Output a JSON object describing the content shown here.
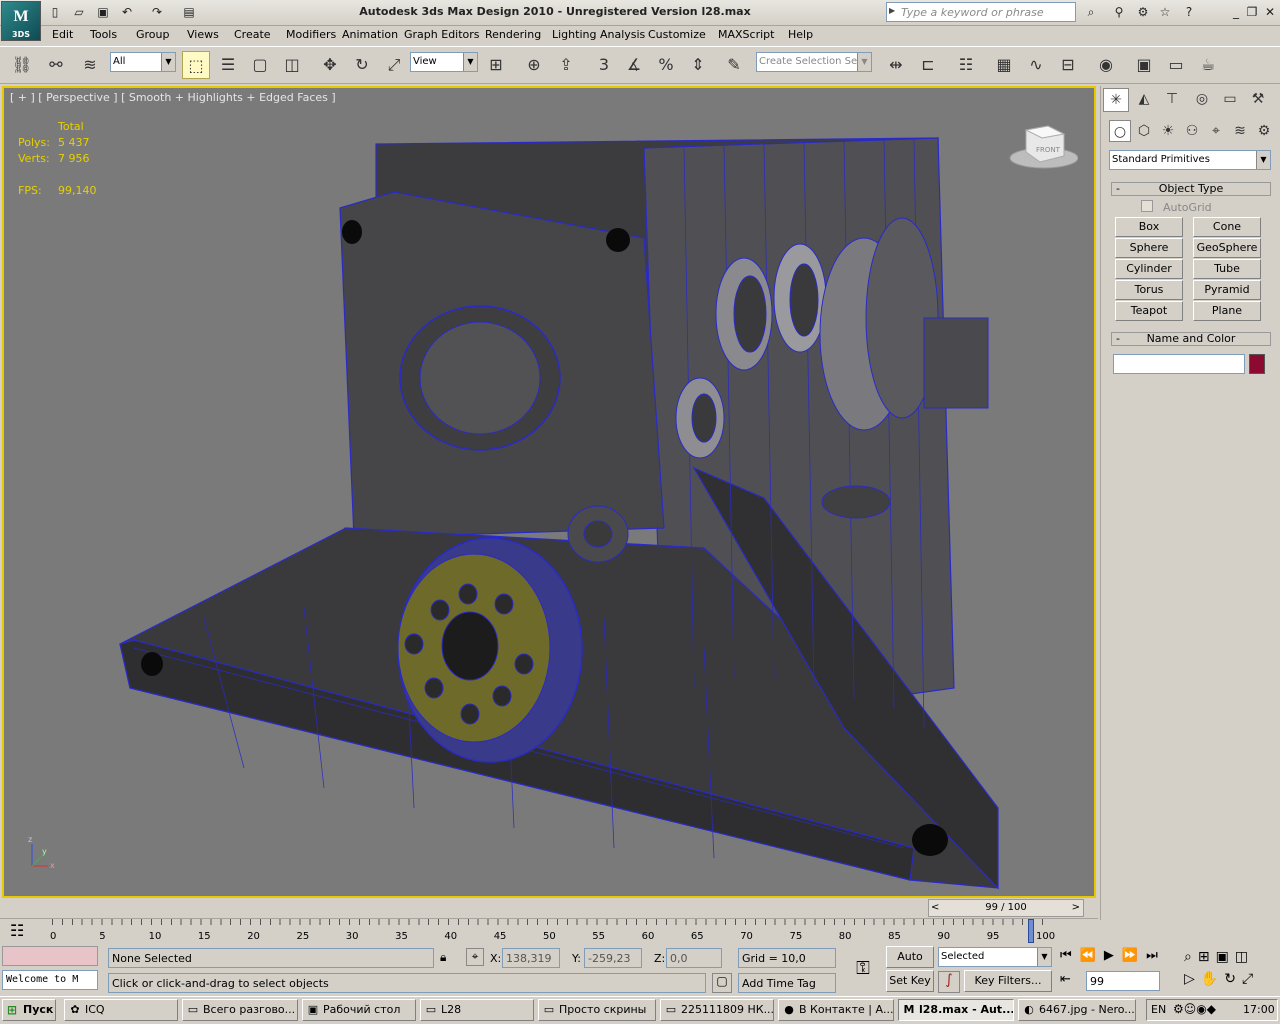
{
  "app": {
    "title": "Autodesk 3ds Max Design 2010    -    Unregistered Version        l28.max",
    "logo_text": "M",
    "logo_sub": "3DS"
  },
  "search": {
    "placeholder": "Type a keyword or phrase"
  },
  "menu": {
    "items": [
      "Edit",
      "Tools",
      "Group",
      "Views",
      "Create",
      "Modifiers",
      "Animation",
      "Graph Editors",
      "Rendering",
      "Lighting Analysis",
      "Customize",
      "MAXScript",
      "Help"
    ]
  },
  "toolbar": {
    "filter_value": "All",
    "refcoord_value": "View",
    "selection_set_placeholder": "Create Selection Se",
    "angle_snap_label": "3",
    "percent_label": "%"
  },
  "viewport": {
    "label": "[ + ] [ Perspective ] [ Smooth + Highlights + Edged Faces ]",
    "stats": {
      "total_label": "Total",
      "polys_label": "Polys:",
      "polys_value": "5 437",
      "verts_label": "Verts:",
      "verts_value": "7 956",
      "fps_label": "FPS:",
      "fps_value": "99,140"
    },
    "viewcube_label": "FRONT",
    "axis_labels": {
      "z": "z",
      "y": "y",
      "x": "x"
    }
  },
  "timeline": {
    "slider_text": "99 / 100",
    "prev": "<",
    "next": ">",
    "ticks": [
      "0",
      "5",
      "10",
      "15",
      "20",
      "25",
      "30",
      "35",
      "40",
      "45",
      "50",
      "55",
      "60",
      "65",
      "70",
      "75",
      "80",
      "85",
      "90",
      "95",
      "100"
    ]
  },
  "status": {
    "listener_text": "Welcome to M",
    "selection": "None Selected",
    "prompt": "Click or click-and-drag to select objects",
    "x_label": "X:",
    "x_value": "138,319",
    "y_label": "Y:",
    "y_value": "-259,23",
    "z_label": "Z:",
    "z_value": "0,0",
    "grid": "Grid = 10,0",
    "add_time_tag": "Add Time Tag",
    "auto_key": "Auto Key",
    "set_key": "Set Key",
    "key_mode": "Selected",
    "key_filters": "Key Filters...",
    "frame": "99"
  },
  "command_panel": {
    "category": "Standard Primitives",
    "object_type_header": "Object Type",
    "autogrid_label": "AutoGrid",
    "buttons": [
      "Box",
      "Cone",
      "Sphere",
      "GeoSphere",
      "Cylinder",
      "Tube",
      "Torus",
      "Pyramid",
      "Teapot",
      "Plane"
    ],
    "name_color_header": "Name and Color",
    "name_value": "",
    "swatch_color": "#8c0a32"
  },
  "taskbar": {
    "start_label": "Пуск",
    "tasks": [
      {
        "label": "ICQ",
        "icon": "icq-icon",
        "glyph": "✿"
      },
      {
        "label": "Всего разгово...",
        "icon": "folder-icon",
        "glyph": "▭"
      },
      {
        "label": "Рабочий стол",
        "icon": "desktop-icon",
        "glyph": "▣"
      },
      {
        "label": "L28",
        "icon": "folder-icon",
        "glyph": "▭"
      },
      {
        "label": "Просто скрины",
        "icon": "folder-icon",
        "glyph": "▭"
      },
      {
        "label": "225111809 НК...",
        "icon": "folder-icon",
        "glyph": "▭"
      },
      {
        "label": "В Контакте | А...",
        "icon": "firefox-icon",
        "glyph": "●"
      },
      {
        "label": "l28.max - Aut...",
        "icon": "max-icon",
        "glyph": "M"
      },
      {
        "label": "6467.jpg - Nero...",
        "icon": "nero-icon",
        "glyph": "◐"
      }
    ],
    "lang": "EN",
    "clock": "17:00"
  },
  "colors": {
    "viewport_bg": "#7a7a7a",
    "active_border": "#e8c800",
    "stats_text": "#e6d000",
    "wireframe": "#2a2ac8"
  }
}
